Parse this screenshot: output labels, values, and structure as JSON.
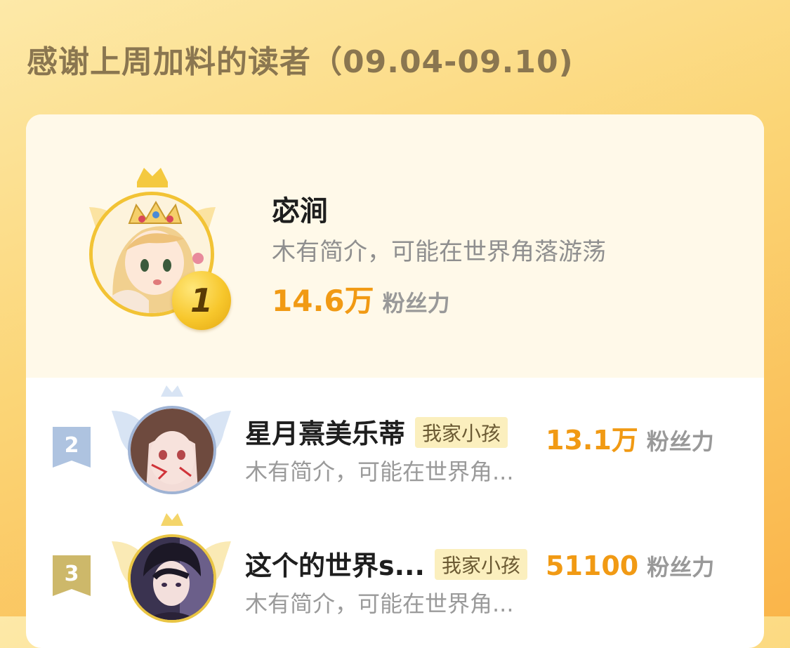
{
  "header": {
    "title": "感谢上周加料的读者（09.04-09.10)"
  },
  "colors": {
    "gold": "#f2c335",
    "silver": "#9fb3d4",
    "bronze": "#c9b46a",
    "accent": "#f19a14"
  },
  "readers": [
    {
      "rank": "1",
      "name": "宓涧",
      "tag": "",
      "intro": "木有简介，可能在世界角落游荡",
      "fans": "14.6万",
      "fans_label": "粉丝力"
    },
    {
      "rank": "2",
      "name": "星月熹美乐蒂",
      "tag": "我家小孩",
      "intro": "木有简介，可能在世界角...",
      "fans": "13.1万",
      "fans_label": "粉丝力"
    },
    {
      "rank": "3",
      "name": "这个的世界s...",
      "tag": "我家小孩",
      "intro": "木有简介，可能在世界角...",
      "fans": "51100",
      "fans_label": "粉丝力"
    }
  ]
}
